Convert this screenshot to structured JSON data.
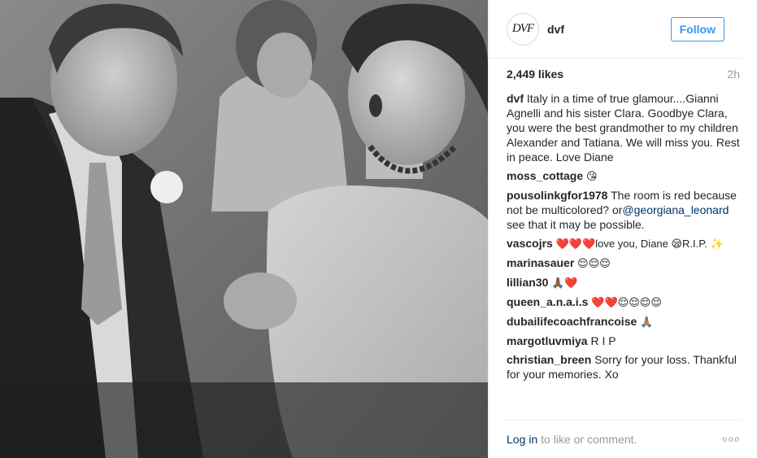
{
  "header": {
    "avatar_text": "DVF",
    "username": "dvf",
    "follow_label": "Follow"
  },
  "stats": {
    "likes": "2,449 likes",
    "time": "2h"
  },
  "caption": {
    "user": "dvf",
    "text": "Italy in a time of true glamour....Gianni Agnelli and his sister Clara. Goodbye Clara, you were the best grandmother to my children Alexander and Tatiana. We will miss you. Rest in peace. Love Diane"
  },
  "comments": [
    {
      "user": "moss_cottage",
      "text": "😘"
    },
    {
      "user": "pousolinkgfor1978",
      "text": "The room is red because not be multicolored? or",
      "mention": "@georgiana_leonard",
      "text_after": " see that it may be possible."
    },
    {
      "user": "vascojrs",
      "text": "❤️❤️❤️love you, Diane 😪R.I.P. ✨"
    },
    {
      "user": "marinasauer",
      "text": "😌😌😌"
    },
    {
      "user": "lillian30",
      "text": "🙏🏾❤️"
    },
    {
      "user": "queen_a.n.a.i.s",
      "text": "❤️❤️😌😌😌😌"
    },
    {
      "user": "dubailifecoachfrancoise",
      "text": "🙏🏽"
    },
    {
      "user": "margotluvmiya",
      "text": "R I P"
    },
    {
      "user": "christian_breen",
      "text": "Sorry for your loss. Thankful for your memories. Xo"
    }
  ],
  "footer": {
    "login_label": "Log in",
    "login_rest": "to like or comment.",
    "more_label": "ooo"
  },
  "colors": {
    "accent": "#3897f0",
    "link": "#003569",
    "muted": "#999999"
  }
}
